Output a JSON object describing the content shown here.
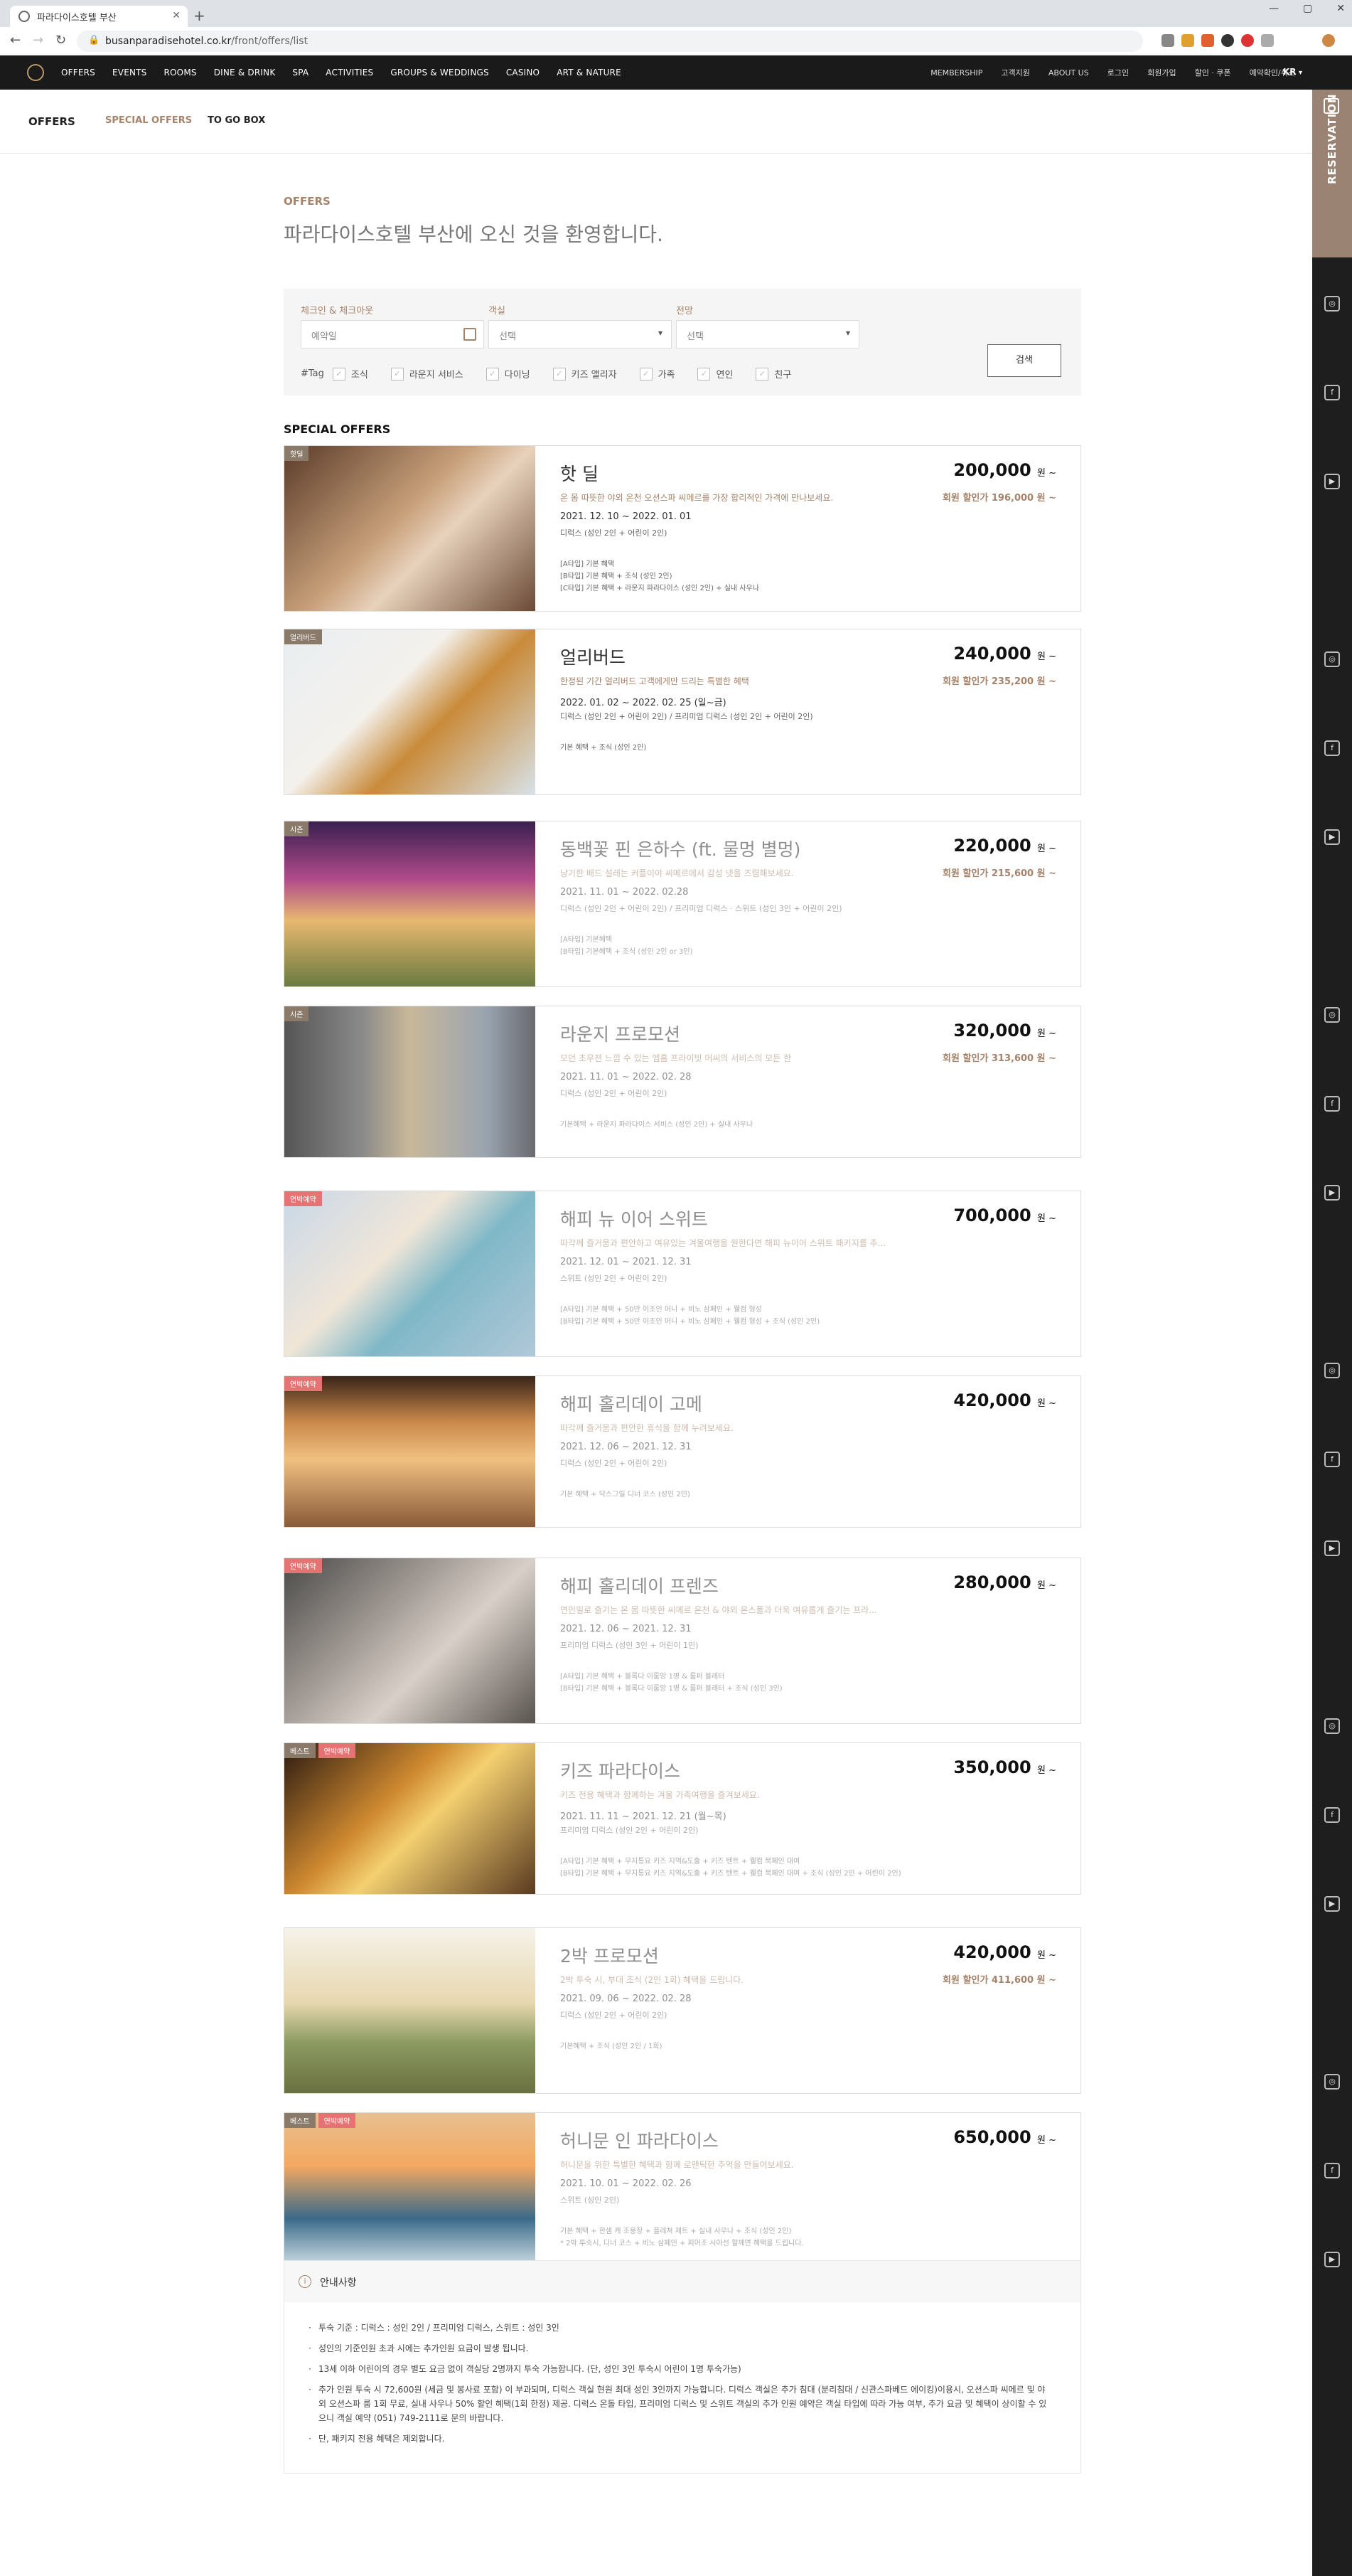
{
  "browser": {
    "tab_title": "파라다이스호텔 부산",
    "url_host": "busanparadisehotel.co.kr",
    "url_path": "/front/offers/list"
  },
  "nav": {
    "main": [
      "OFFERS",
      "EVENTS",
      "ROOMS",
      "DINE & DRINK",
      "SPA",
      "ACTIVITIES",
      "GROUPS & WEDDINGS",
      "CASINO",
      "ART & NATURE"
    ],
    "util": [
      "MEMBERSHIP",
      "고객지원",
      "ABOUT US",
      "로그인",
      "회원가입",
      "할인 · 쿠폰",
      "예약확인/취소"
    ],
    "lang": "KR"
  },
  "subnav": {
    "title": "OFFERS",
    "items": [
      "SPECIAL OFFERS",
      "TO GO BOX"
    ]
  },
  "sidebar": {
    "reservation": "RESERVATION"
  },
  "page": {
    "label": "OFFERS",
    "welcome": "파라다이스호텔 부산에 오신 것을 환영합니다."
  },
  "search": {
    "checkin_label": "체크인 & 체크아웃",
    "checkin_value": "예약일",
    "room_label": "객실",
    "room_value": "선택",
    "view_label": "전망",
    "view_value": "선택",
    "tag_label": "#Tag",
    "tags": [
      "조식",
      "라운지 서비스",
      "다이닝",
      "키즈 앨리자",
      "가족",
      "연인",
      "친구"
    ],
    "button": "검색"
  },
  "special_title": "SPECIAL OFFERS",
  "offers": [
    {
      "badges": [
        "핫딜"
      ],
      "name": "핫 딜",
      "desc": "온 몸 따뜻한 야외 온천 오션스파 씨메르를 가장 합리적인 가격에 만나보세요.",
      "dates": "2021. 12. 10 ~ 2022. 01. 01",
      "rooms": "디럭스 (성인 2인 + 어린이 2인)",
      "incl": [
        "[A타입] 기본 혜택",
        "[B타입] 기본 혜택 + 조식 (성인 2인)",
        "[C타입] 기본 혜택 + 라운지 파라다이스 (성인 2인) + 실내 사우나"
      ],
      "price": "200,000",
      "won": "원 ~",
      "member": "회원 할인가 196,000 원 ~"
    },
    {
      "badges": [
        "얼리버드"
      ],
      "name": "얼리버드",
      "desc": "한정된 기간 얼리버드 고객에게만 드리는 특별한 혜택",
      "dates": "2022. 01. 02 ~ 2022. 02. 25 (일~금)",
      "rooms": "디럭스 (성인 2인 + 어린이 2인) / 프리미엄 디럭스 (성인 2인 + 어린이 2인)",
      "incl": [
        "기본 혜택 + 조식 (성인 2인)"
      ],
      "price": "240,000",
      "won": "원 ~",
      "member": "회원 할인가 235,200 원 ~"
    },
    {
      "badges": [
        "시즌"
      ],
      "name": "동백꽃 핀 은하수 (ft. 물멍 별멍)",
      "desc": "낭기한 배드 설레는 커플이야 씨메르에서 감성 넷을 즈렴해보세요.",
      "dates": "2021. 11. 01 ~ 2022. 02.28",
      "rooms": "디럭스 (성인 2인 + 어린이 2인) / 프리미엄 디럭스 · 스위트 (성인 3인 + 어린이 2인)",
      "incl": [
        "[A타입] 기본혜택",
        "[B타입] 기본혜택 + 조식 (성인 2인 or 3인)"
      ],
      "price": "220,000",
      "won": "원 ~",
      "member": "회원 할인가 215,600 원 ~"
    },
    {
      "badges": [
        "시즌"
      ],
      "name": "라운지 프로모션",
      "desc": "모던 초우젼 느낌 수 있는 엠홈 프라이빗 머씨의 서비스의 모든 한",
      "dates": "2021. 11. 01 ~ 2022. 02. 28",
      "rooms": "디럭스 (성인 2인 + 어린이 2인)",
      "incl": [
        "기본혜택 + 라운지 파라다이스 서비스 (성인 2인) + 실내 사우나"
      ],
      "price": "320,000",
      "won": "원 ~",
      "member": "회원 할인가 313,600 원 ~"
    },
    {
      "badges": [
        "연박예약"
      ],
      "name": "해피 뉴 이어 스위트",
      "desc": "따각께 즐거움과 편안하고 여유있는 겨울여행을 원한다면 해피 뉴이어 스위트 패키지를 추...",
      "dates": "2021. 12. 01 ~ 2021. 12. 31",
      "rooms": "스위트 (성인 2인 + 어린이 2인)",
      "incl": [
        "[A타입] 기본 혜택 + 50만 이조인 머니 + 비노 삼페인 + 웰컴 형성",
        "[B타입] 기본 혜택 + 50만 이조인 머니 + 비노 삼페인 + 웰컴 형성 + 조식 (성인 2인)"
      ],
      "price": "700,000",
      "won": "원 ~",
      "member": ""
    },
    {
      "badges": [
        "연박예약"
      ],
      "name": "해피 홀리데이 고메",
      "desc": "따각께 즐거움과 편안한 휴식을 함께 누려보세요.",
      "dates": "2021. 12. 06 ~ 2021. 12. 31",
      "rooms": "디럭스 (성인 2인 + 어린이 2인)",
      "incl": [
        "기본 혜택 + 닥스그릴 디너 코스 (성인 2인)"
      ],
      "price": "420,000",
      "won": "원 ~",
      "member": ""
    },
    {
      "badges": [
        "연박예약"
      ],
      "name": "해피 홀리데이 프렌즈",
      "desc": "연인일로 즐기는 온 몸 따뜻한 씨메르 온천 & 야외 온스풀과 더욱 여유롭게 즐기는 프라...",
      "dates": "2021. 12. 06 ~ 2021. 12. 31",
      "rooms": "프리미엄 디럭스 (성인 3인 + 어린이 1인)",
      "incl": [
        "[A타입] 기본 혜택 + 블록다 이룸앙 1병 & 룸퍼 블레터",
        "[B타입] 기본 혜택 + 블록다 이룸앙 1병 & 룸퍼 블레터 + 조식 (성인 3인)"
      ],
      "price": "280,000",
      "won": "원 ~",
      "member": ""
    },
    {
      "badges": [
        "베스트",
        "연박예약"
      ],
      "name": "키즈 파라다이스",
      "desc": "키즈 전용 혜택과 함께하는 겨울 가족여행을 즐겨보세요.",
      "dates": "2021. 11. 11 ~ 2021. 12. 21 (월~목)",
      "rooms": "프리미엄 디럭스 (성인 2인 + 어린이 2인)",
      "incl": [
        "[A타입] 기본 혜택 + 무지통요 키즈 지역&도출 + 키즈 텐트 + 웰컴 북페인 대여",
        "[B타입] 기본 혜택 + 무지통요 키즈 지역&도출 + 키즈 텐트 + 웰컴 북페인 대여 + 조식 (성인 2인 + 어린이 2인)"
      ],
      "price": "350,000",
      "won": "원 ~",
      "member": ""
    },
    {
      "badges": [],
      "name": "2박 프로모션",
      "desc": "2박 투숙 시, 부대 조식 (2인 1회) 혜택을 드립니다.",
      "dates": "2021. 09. 06 ~ 2022. 02. 28",
      "rooms": "디럭스 (성인 2인 + 어린이 2인)",
      "incl": [
        "기본혜택 + 조식 (성인 2인 / 1회)"
      ],
      "price": "420,000",
      "won": "원 ~",
      "member": "회원 할인가 411,600 원 ~"
    },
    {
      "badges": [
        "베스트",
        "연박예약"
      ],
      "name": "허니문 인 파라다이스",
      "desc": "허니문을 위한 특별한 혜택과 함께 로맨틱한 추억을 만들어보세요.",
      "dates": "2021. 10. 01 ~ 2022. 02. 26",
      "rooms": "스위트 (성인 2인)",
      "incl": [
        "기본 혜택 + 한샘 캐 조용장 + 플레쳐 제트 + 실내 사우나 + 조식 (성인 2인)",
        "* 2박 투숙시, 디너 코스 + 비노 삼페인 + 피어조 시아선 할께면 혜택을 드립니다."
      ],
      "price": "650,000",
      "won": "원 ~",
      "member": ""
    }
  ],
  "notice": {
    "title": "안내사항",
    "items": [
      "투숙 기준 : 디럭스 : 성인 2인 / 프리미엄 디럭스, 스위트 : 성인 3인",
      "성인의 기준인원 초과 시에는 추가인원 요금이 발생 됩니다.",
      "13세 이하 어린이의 경우 별도 요금 없이 객실당 2명까지 투숙 가능합니다. (단, 성인 3인 투숙시 어린이 1명 투숙가능)",
      "추가 인원 투숙 시 72,600원 (세금 및 봉사료 포함) 이 부과되며, 디럭스 객실 현원 최대 성인 3인까지 가능합니다. 디럭스 객실은 추가 침대 (분리침대 / 신관스파베드 에이킹)이용시, 오션스파 씨메르 및 야외 오션스파 룸 1회 무료, 실내 사우나 50% 할인 혜택(1회 한정) 제공. 디럭스 온돌 타입, 프리미엄 디럭스 및 스위트 객실의 추가 인원 예약은 객실 타입에 따라 가능 여부, 추가 요금 및 혜택이 상이할 수 있으니 객실 예약 (051) 749-2111로 문의 바랍니다.",
      "단, 패키지 전용 혜택은 제외합니다."
    ]
  },
  "colors": {
    "accent": "#a5826a",
    "nav_bg": "#1a1a1a",
    "badge": "#e57373"
  }
}
